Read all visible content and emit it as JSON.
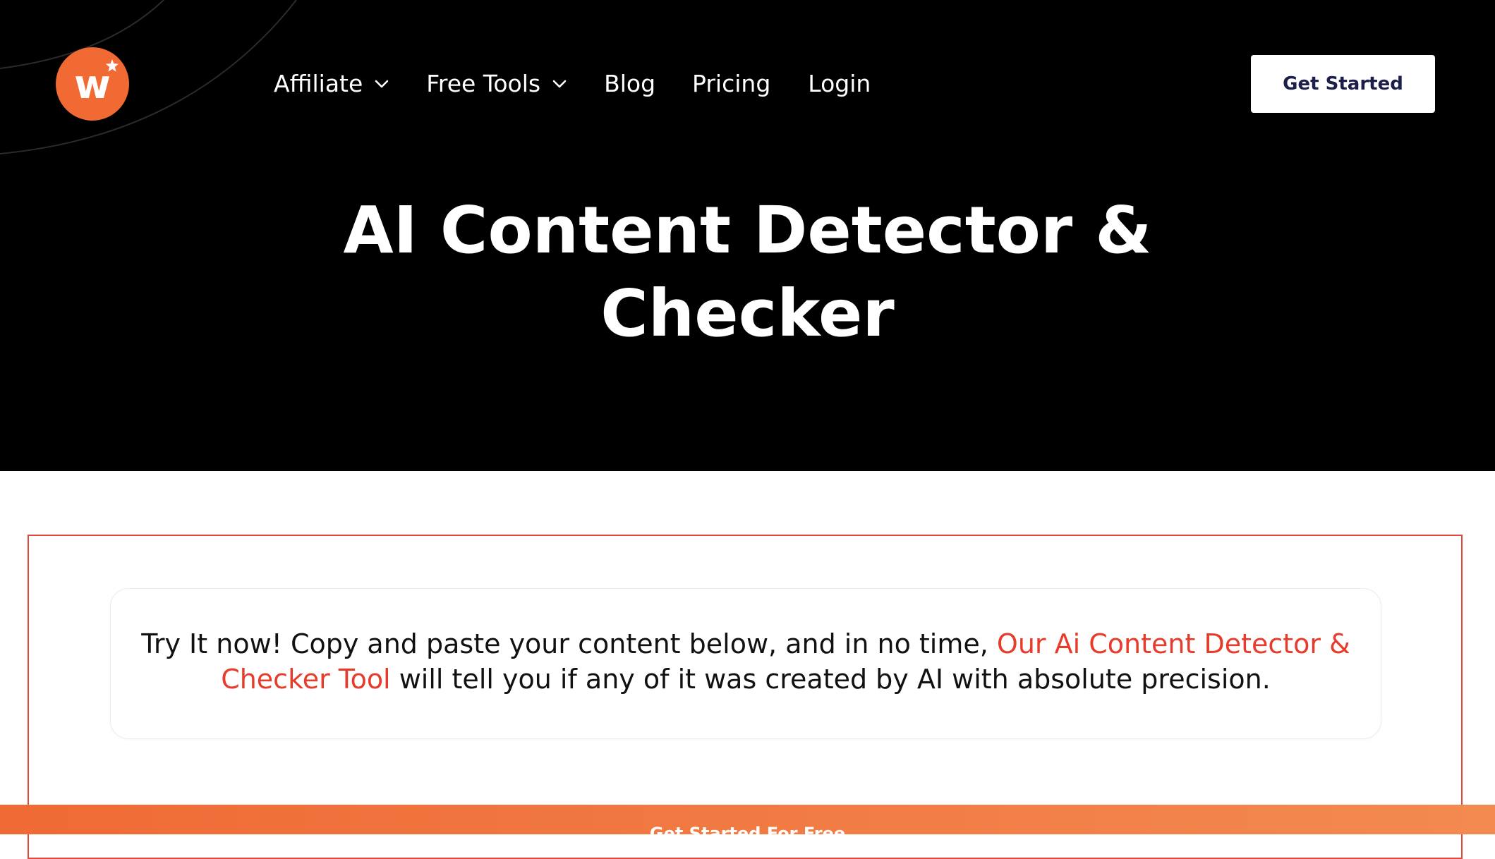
{
  "brand": {
    "logo_letter": "w",
    "accent_color": "#f26a33"
  },
  "nav": {
    "items": [
      {
        "label": "Affiliate",
        "has_dropdown": true
      },
      {
        "label": "Free Tools",
        "has_dropdown": true
      },
      {
        "label": "Blog",
        "has_dropdown": false
      },
      {
        "label": "Pricing",
        "has_dropdown": false
      },
      {
        "label": "Login",
        "has_dropdown": false
      }
    ],
    "cta_label": "Get Started"
  },
  "hero": {
    "title_line1": "AI Content Detector &",
    "title_line2": "Checker"
  },
  "intro": {
    "text_before": "Try It now! Copy and paste your content below, and in no time, ",
    "highlight": "Our Ai Content Detector & Checker Tool",
    "text_after": " will tell you if any of it was created by AI with absolute precision.",
    "highlight_color": "#e73b2b"
  },
  "bottom_bar": {
    "label": "Get Started For Free"
  },
  "icons": {
    "dropdown": "chevron-down-icon",
    "logo_star": "star-icon"
  }
}
